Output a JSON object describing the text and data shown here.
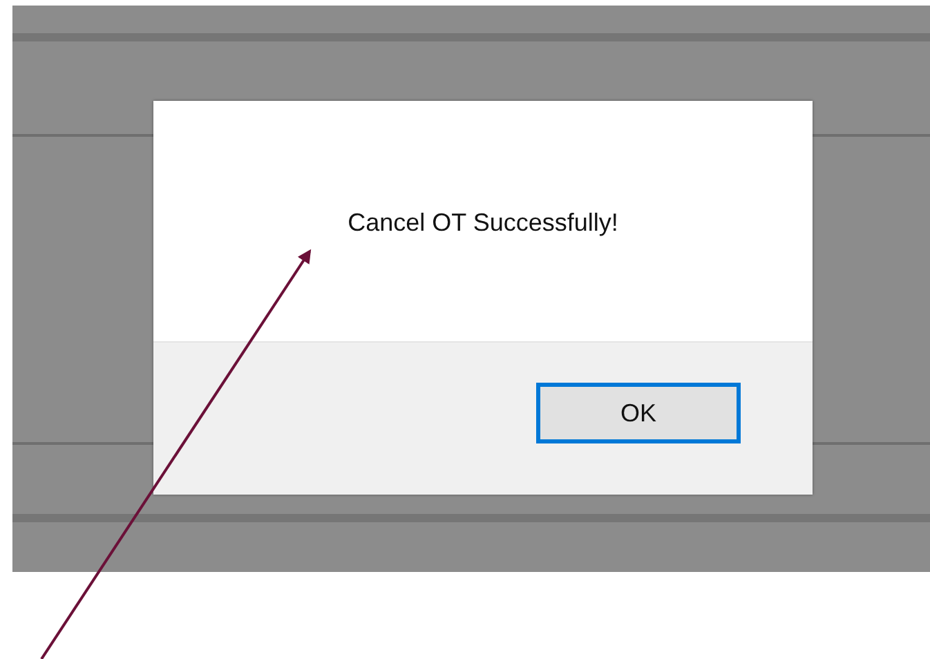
{
  "dialog": {
    "message": "Cancel OT Successfully!",
    "buttons": [
      {
        "label": "OK",
        "focused": true
      }
    ]
  }
}
